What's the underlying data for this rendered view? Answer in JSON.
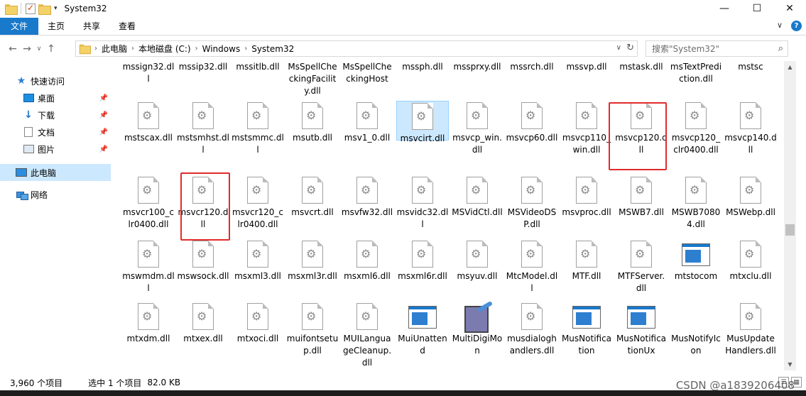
{
  "window": {
    "title": "System32"
  },
  "window_controls": {
    "minimize": "—",
    "maximize": "☐",
    "close": "✕"
  },
  "ribbon": {
    "file_tab": "文件",
    "tabs": [
      "主页",
      "共享",
      "查看"
    ],
    "expand": "∨",
    "help": "?"
  },
  "nav": {
    "back": "←",
    "forward": "→",
    "recent": "∨",
    "up": "↑"
  },
  "address": {
    "crumbs": [
      "此电脑",
      "本地磁盘 (C:)",
      "Windows",
      "System32"
    ],
    "dropdown": "∨",
    "refresh": "↻"
  },
  "search": {
    "placeholder": "搜索\"System32\""
  },
  "sidebar": {
    "items": [
      {
        "label": "快速访问"
      },
      {
        "label": "桌面"
      },
      {
        "label": "下载"
      },
      {
        "label": "文档"
      },
      {
        "label": "图片"
      },
      {
        "label": "此电脑"
      },
      {
        "label": "网络"
      }
    ]
  },
  "files": {
    "row0": [
      "mssign32.dll",
      "mssip32.dll",
      "mssitlb.dll",
      "MsSpellCheckingFacility.dll",
      "MsSpellCheckingHost",
      "mssph.dll",
      "mssprxy.dll",
      "mssrch.dll",
      "mssvp.dll",
      "mstask.dll",
      "msTextPrediction.dll",
      "mstsc"
    ],
    "row1": [
      "mstscax.dll",
      "mstsmhst.dll",
      "mstsmmc.dll",
      "msutb.dll",
      "msv1_0.dll",
      "msvcirt.dll",
      "msvcp_win.dll",
      "msvcp60.dll",
      "msvcp110_win.dll",
      "msvcp120.dll",
      "msvcp120_clr0400.dll",
      "msvcp140.dll"
    ],
    "row2": [
      "msvcr100_clr0400.dll",
      "msvcr120.dll",
      "msvcr120_clr0400.dll",
      "msvcrt.dll",
      "msvfw32.dll",
      "msvidc32.dll",
      "MSVidCtl.dll",
      "MSVideoDSP.dll",
      "msvproc.dll",
      "MSWB7.dll",
      "MSWB70804.dll",
      "MSWebp.dll"
    ],
    "row3": [
      "mswmdm.dll",
      "mswsock.dll",
      "msxml3.dll",
      "msxml3r.dll",
      "msxml6.dll",
      "msxml6r.dll",
      "msyuv.dll",
      "MtcModel.dll",
      "MTF.dll",
      "MTFServer.dll",
      "mtstocom",
      "mtxclu.dll"
    ],
    "row4": [
      "mtxdm.dll",
      "mtxex.dll",
      "mtxoci.dll",
      "muifontsetup.dll",
      "MUILanguageCleanup.dll",
      "MuiUnattend",
      "MultiDigiMon",
      "musdialoghandlers.dll",
      "MusNotification",
      "MusNotificationUx",
      "MusNotifyIcon",
      "MusUpdateHandlers.dll"
    ]
  },
  "scroll": {
    "up": "▲",
    "down": "▼"
  },
  "status": {
    "count": "3,960 个项目",
    "selected": "选中 1 个项目",
    "size": "82.0 KB"
  },
  "watermark": "CSDN @a1839206408"
}
